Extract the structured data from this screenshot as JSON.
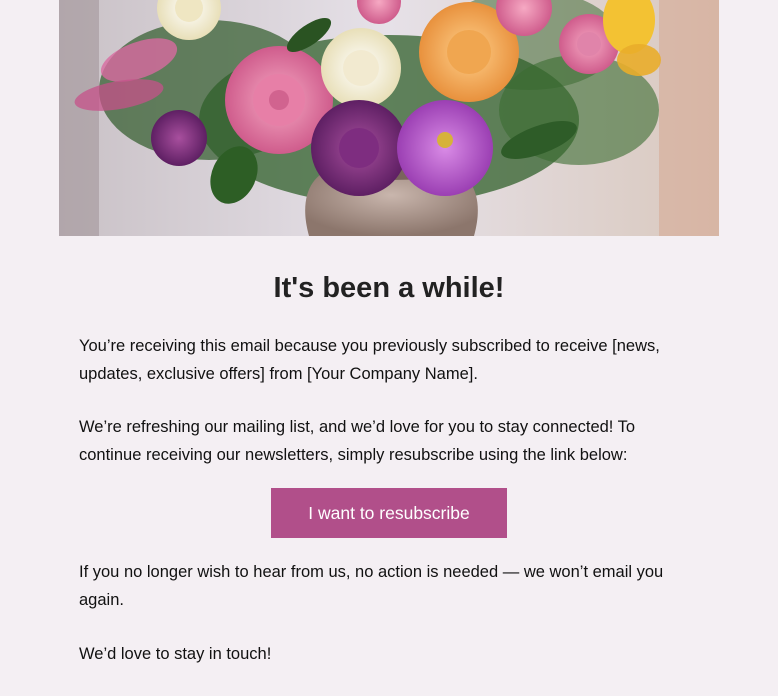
{
  "email": {
    "headline": "It's been a while!",
    "paragraph_1": "You’re receiving this email because you previously subscribed to receive [news, updates, exclusive offers] from [Your Company Name].",
    "paragraph_2": "We’re refreshing our mailing list, and we’d love for you to stay connected! To continue receiving our newsletters, simply resubscribe using the link below:",
    "cta_label": "I want to resubscribe",
    "paragraph_3": "If you no longer wish to hear from us, no action is needed — we won’t email you again.",
    "paragraph_4": "We’d love to stay in touch!"
  },
  "colors": {
    "background": "#f4eff3",
    "cta": "#b14f8a",
    "cta_text": "#ffffff",
    "heading": "#222222"
  }
}
